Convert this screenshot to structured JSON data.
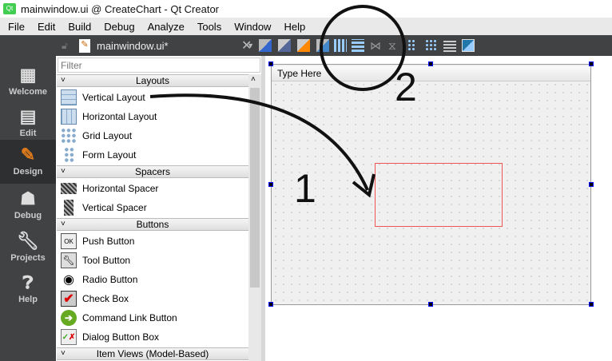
{
  "window": {
    "title": "mainwindow.ui @ CreateChart - Qt Creator",
    "logo": "Qt"
  },
  "menu": [
    "File",
    "Edit",
    "Build",
    "Debug",
    "Analyze",
    "Tools",
    "Window",
    "Help"
  ],
  "document": {
    "name": "mainwindow.ui*"
  },
  "modes": [
    {
      "label": "Welcome",
      "icon": "grid-icon"
    },
    {
      "label": "Edit",
      "icon": "document-icon"
    },
    {
      "label": "Design",
      "icon": "pencil-icon"
    },
    {
      "label": "Debug",
      "icon": "bug-icon"
    },
    {
      "label": "Projects",
      "icon": "wrench-icon"
    },
    {
      "label": "Help",
      "icon": "help-icon"
    }
  ],
  "widget_box": {
    "filter_placeholder": "Filter",
    "sections": [
      {
        "title": "Layouts",
        "items": [
          "Vertical Layout",
          "Horizontal Layout",
          "Grid Layout",
          "Form Layout"
        ]
      },
      {
        "title": "Spacers",
        "items": [
          "Horizontal Spacer",
          "Vertical Spacer"
        ]
      },
      {
        "title": "Buttons",
        "items": [
          "Push Button",
          "Tool Button",
          "Radio Button",
          "Check Box",
          "Command Link Button",
          "Dialog Button Box"
        ]
      },
      {
        "title": "Item Views (Model-Based)",
        "items": []
      }
    ]
  },
  "form": {
    "menu_placeholder": "Type Here"
  },
  "annotations": {
    "step1": "1",
    "step2": "2"
  },
  "colors": {
    "dark": "#404244",
    "active_mode": "#2e2f30",
    "selection_rect": "#e55555",
    "handle": "#0000ff"
  }
}
